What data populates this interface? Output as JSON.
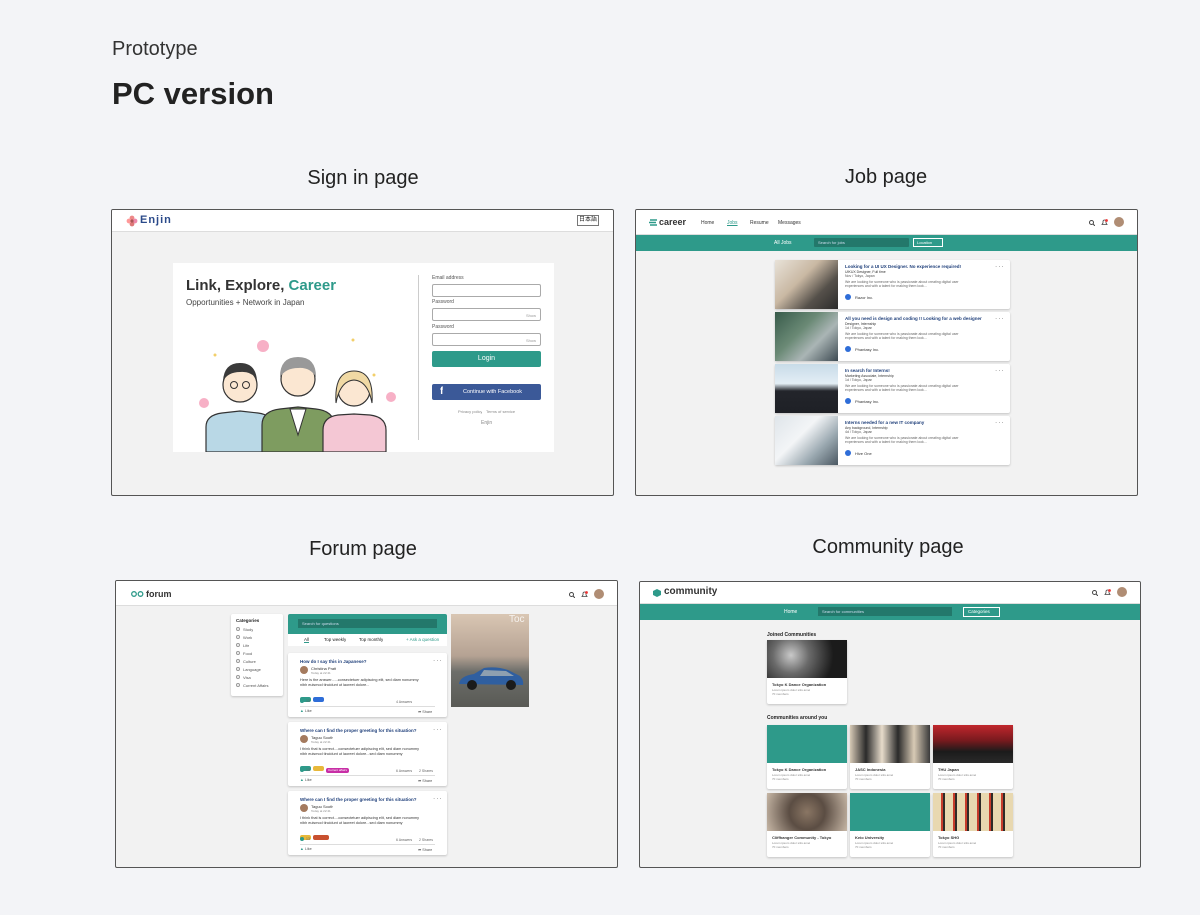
{
  "header": {
    "subtitle": "Prototype",
    "title": "PC version"
  },
  "pages": {
    "signin": {
      "label": "Sign in page"
    },
    "job": {
      "label": "Job page"
    },
    "forum": {
      "label": "Forum page"
    },
    "community": {
      "label": "Community page"
    }
  },
  "signin": {
    "logo": "Enjin",
    "lang": "日本語",
    "headline_a": "Link, Explore, ",
    "headline_b": "Career",
    "tagline": "Opportunities + Network in Japan",
    "email_label": "Email address",
    "password_label": "Password",
    "password2_label": "Password",
    "show1": "Show",
    "show2": "Show",
    "login": "Login",
    "facebook": "Continue with Facebook",
    "privacy": "Privacy policy",
    "terms": "Terms of service",
    "signup": "Enjin",
    "colors": {
      "accent": "#2e9a8a",
      "facebook": "#3b5998"
    }
  },
  "job": {
    "logo": "career",
    "nav": [
      "Home",
      "Jobs",
      "Resume",
      "Messages"
    ],
    "filter": "All Jobs",
    "search_placeholder": "Search for jobs",
    "location": "Location",
    "cards": [
      {
        "title": "Looking for a UI UX Designer. No experience required!",
        "sub": "UIKUX Designer, Full time",
        "loc": "Nov / Tokyo, Japan",
        "d1": "We are looking for someone who is passionate about creating digital user",
        "d2": "experiences and with a talent for making them look...",
        "company": "Razor Inc."
      },
      {
        "title": "All you need is design and coding !! Looking for a web designer",
        "sub": "Designer, Internship",
        "loc": "1d / Tokyo, Japan",
        "d1": "We are looking for someone who is passionate about creating digital user",
        "d2": "experiences and with a talent for making them look...",
        "company": "Phantasy Inc."
      },
      {
        "title": "In search for Interns!",
        "sub": "Marketing Associate, Internship",
        "loc": "1d / Tokyo, Japan",
        "d1": "We are looking for someone who is passionate about creating digital user",
        "d2": "experiences and with a talent for making them look...",
        "company": "Phantasy Inc."
      },
      {
        "title": "Interns needed for a new IT company",
        "sub": "Any background, Internship",
        "loc": "4d / Tokyo, Japan",
        "d1": "We are looking for someone who is passionate about creating digital user",
        "d2": "experiences and with a talent for making them look...",
        "company": "Hive One"
      }
    ]
  },
  "forum": {
    "logo": "forum",
    "categories_title": "Categories",
    "categories": [
      "Study",
      "Work",
      "Life",
      "Food",
      "Culture",
      "Language",
      "Visa",
      "Current Affairs"
    ],
    "search_placeholder": "Search for questions",
    "tabs": [
      "All",
      "Top weekly",
      "Top monthly"
    ],
    "ask": "+ Ask a question",
    "ad_label": "Toc",
    "posts": [
      {
        "title": "How do I say this in Japanese?",
        "author": "Christina Pratt",
        "time": "Today at 22:41",
        "b1": "Here is the answer......consectetuer adipiscing elit, sed diam nonummy",
        "b2": "nibh euismod tincidunt ut laoreet dolore...",
        "votes": "13",
        "answers": "4 Answers",
        "likes": "Like",
        "share": "Share"
      },
      {
        "title": "Where can I find the proper greeting for this situation?",
        "author": "Taguu Sooth",
        "time": "Today at 22:41",
        "b1": "I think that is correct....consectetuer adipiscing elit, sed diam nonummy",
        "b2": "nibh euismod tincidunt ut laoreet dolore...sed diam nonummy",
        "tag": "Current affairs",
        "votes": "13",
        "answers": "6 Answers",
        "shares": "2 Shares",
        "likes": "Like",
        "share": "Share"
      },
      {
        "title": "Where can I find the proper greeting for this situation?",
        "author": "Taguu Sooth",
        "time": "Today at 22:41",
        "b1": "I think that is correct....consectetuer adipiscing elit, sed diam nonummy",
        "b2": "nibh euismod tincidunt ut laoreet dolore...sed diam nonummy",
        "votes": "13",
        "answers": "6 Answers",
        "shares": "2 Shares",
        "likes": "Like",
        "share": "Share"
      }
    ]
  },
  "community": {
    "logo": "community",
    "home": "Home",
    "search_placeholder": "Search for communities",
    "categories": "Categories",
    "joined_title": "Joined Communities",
    "joined": [
      {
        "name": "Tokyo K Dance Organization",
        "l1": "Lorem ipsum dolor sitis amet",
        "l2": "70 members"
      }
    ],
    "around_title": "Communities around you",
    "around": [
      {
        "name": "Tokyo K Dance Organization",
        "l1": "Lorem ipsum dolor sitis amet",
        "l2": "70 members"
      },
      {
        "name": "JASC Indonesia",
        "l1": "Lorem ipsum dolor sitis amet",
        "l2": "70 members"
      },
      {
        "name": "THU Japan",
        "l1": "Lorem ipsum dolor sitis amet",
        "l2": "70 members"
      },
      {
        "name": "Cliffhanger Community - Tokyo",
        "l1": "Lorem ipsum dolor sitis amet",
        "l2": "70 members"
      },
      {
        "name": "Keio University",
        "l1": "Lorem ipsum dolor sitis amet",
        "l2": "70 members"
      },
      {
        "name": "Tokyo SHG",
        "l1": "Lorem ipsum dolor sitis amet",
        "l2": "70 members"
      }
    ]
  }
}
